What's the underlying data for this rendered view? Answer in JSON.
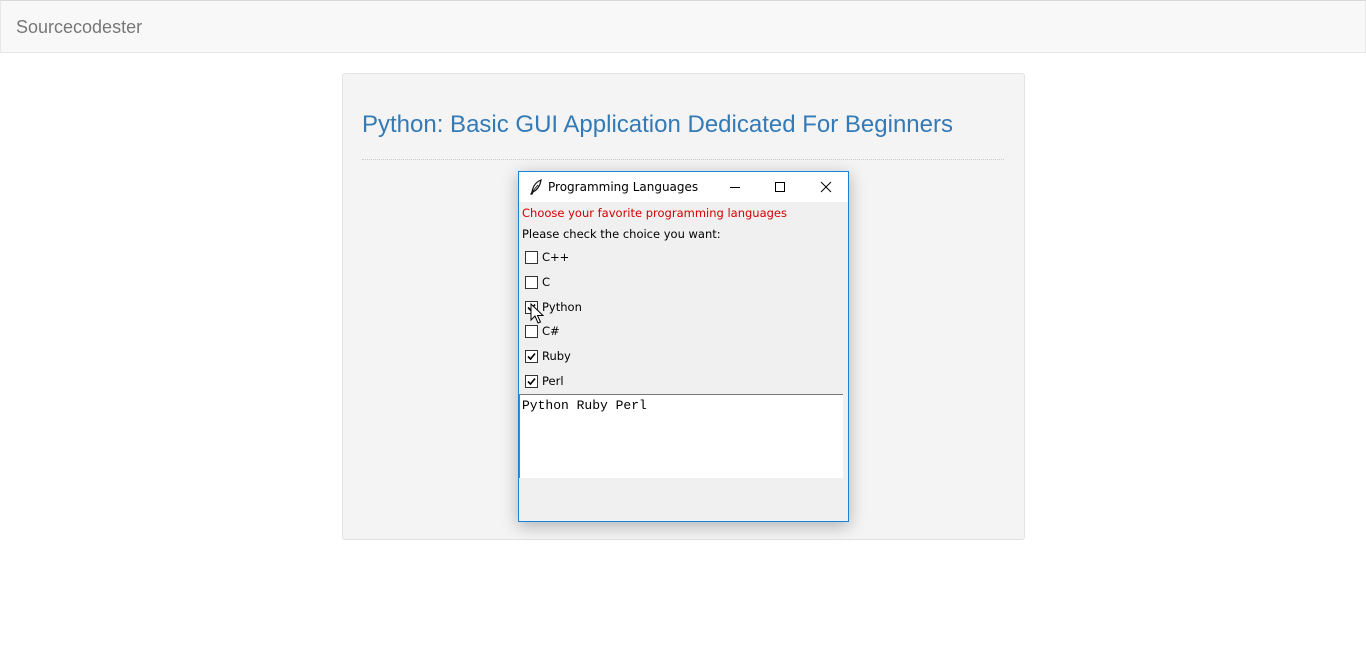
{
  "navbar": {
    "brand": "Sourcecodester"
  },
  "page": {
    "title": "Python: Basic GUI Application Dedicated For Beginners"
  },
  "window": {
    "title": "Programming Languages",
    "icon": "feather-icon",
    "controls": [
      "minimize-icon",
      "maximize-icon",
      "close-icon"
    ],
    "heading": "Choose your favorite programming languages",
    "heading_color": "#d40000",
    "instruction": "Please check the choice you want:",
    "checkboxes": [
      {
        "label": "C++",
        "checked": false
      },
      {
        "label": "C",
        "checked": false
      },
      {
        "label": "Python",
        "checked": true
      },
      {
        "label": "C#",
        "checked": false
      },
      {
        "label": "Ruby",
        "checked": true
      },
      {
        "label": "Perl",
        "checked": true
      }
    ],
    "output_text": "Python Ruby Perl",
    "border_color": "#1883d7"
  },
  "colors": {
    "title_link": "#337ab7",
    "brand_text": "#777777"
  }
}
